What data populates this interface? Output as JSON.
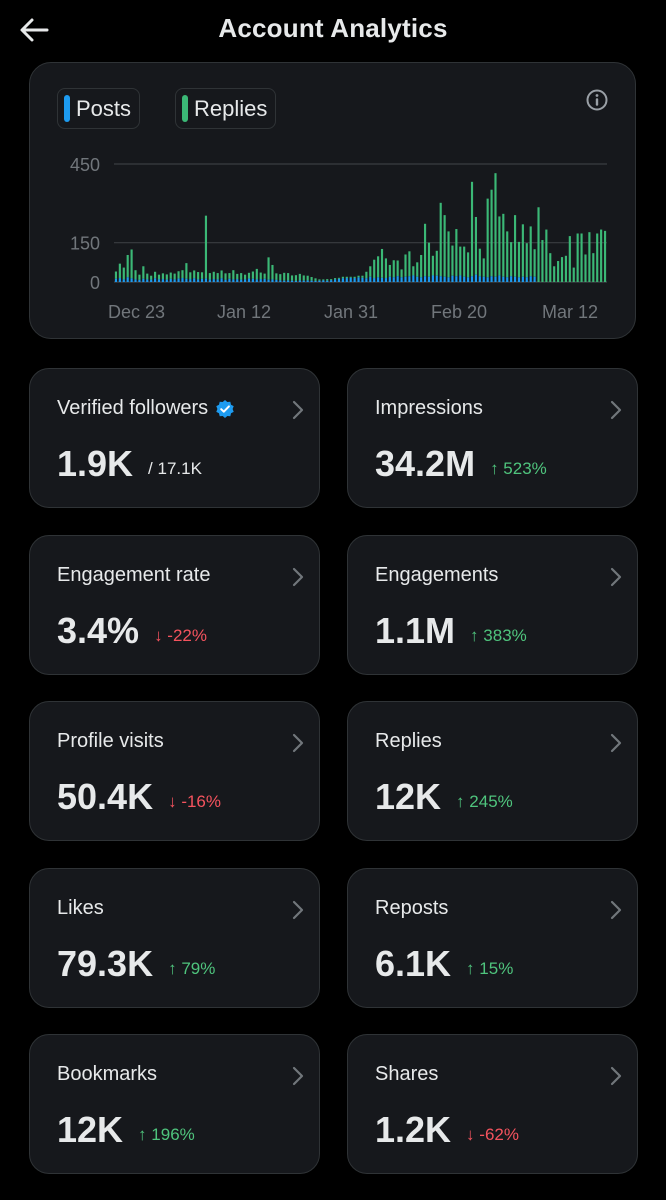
{
  "header": {
    "title": "Account Analytics"
  },
  "chart": {
    "legend": [
      {
        "label": "Posts",
        "color": "#1d9bf0"
      },
      {
        "label": "Replies",
        "color": "#3bb876"
      }
    ]
  },
  "chart_data": {
    "type": "bar",
    "title": "",
    "xlabel": "",
    "ylabel": "",
    "ylim": [
      0,
      450
    ],
    "yticks": [
      "450",
      "150",
      "0"
    ],
    "xtick_labels": [
      "Dec 23",
      "Jan 12",
      "Jan 31",
      "Feb 20",
      "Mar 12"
    ],
    "grid": true,
    "stacked": true,
    "series": [
      {
        "name": "Posts",
        "color": "#1d9bf0",
        "values": [
          12,
          15,
          10,
          18,
          14,
          10,
          8,
          12,
          10,
          9,
          14,
          10,
          11,
          9,
          12,
          10,
          13,
          15,
          12,
          11,
          14,
          10,
          12,
          13,
          9,
          11,
          10,
          14,
          8,
          12,
          10,
          11,
          9,
          10,
          13,
          12,
          10,
          11,
          12,
          9,
          10,
          8,
          6,
          5,
          6,
          5,
          4,
          6,
          5,
          6,
          5,
          4,
          5,
          6,
          5,
          7,
          10,
          12,
          14,
          15,
          16,
          15,
          18,
          16,
          14,
          20,
          15,
          18,
          16,
          15,
          20,
          18,
          22,
          18,
          20,
          22,
          25,
          20,
          18,
          22,
          20,
          25,
          24,
          22,
          20,
          18,
          24,
          22,
          25,
          20,
          18,
          22,
          28,
          22,
          20,
          18,
          22,
          20,
          25,
          20,
          18,
          22,
          20,
          18,
          20,
          18,
          22,
          20
        ]
      },
      {
        "name": "Replies",
        "color": "#3bb876",
        "values": [
          28,
          55,
          45,
          85,
          110,
          35,
          20,
          48,
          22,
          15,
          25,
          18,
          22,
          20,
          24,
          22,
          28,
          30,
          60,
          26,
          30,
          28,
          25,
          240,
          25,
          28,
          24,
          30,
          25,
          22,
          35,
          20,
          25,
          18,
          22,
          28,
          40,
          25,
          20,
          85,
          55,
          25,
          24,
          30,
          28,
          20,
          22,
          25,
          20,
          18,
          14,
          10,
          5,
          4,
          6,
          4,
          5,
          4,
          6,
          5,
          4,
          5,
          6,
          8,
          25,
          40,
          70,
          80,
          110,
          75,
          45,
          65,
          60,
          30,
          85,
          95,
          35,
          55,
          85,
          200,
          130,
          75,
          95,
          280,
          235,
          175,
          115,
          180,
          110,
          115,
          95,
          360,
          220,
          105,
          70,
          300,
          330,
          395,
          225,
          240,
          175,
          130,
          235,
          135,
          200,
          130,
          190,
          105,
          285,
          160,
          200,
          110,
          60,
          80,
          95,
          100,
          175,
          55,
          185,
          185,
          105,
          190,
          110,
          185,
          200,
          195
        ]
      }
    ]
  },
  "stats": [
    {
      "label": "Verified followers",
      "value": "1.9K",
      "sub": "/ 17.1K"
    },
    {
      "label": "Impressions",
      "value": "34.2M",
      "change": "523%",
      "direction": "up"
    },
    {
      "label": "Engagement rate",
      "value": "3.4%",
      "change": "-22%",
      "direction": "down"
    },
    {
      "label": "Engagements",
      "value": "1.1M",
      "change": "383%",
      "direction": "up"
    },
    {
      "label": "Profile visits",
      "value": "50.4K",
      "change": "-16%",
      "direction": "down"
    },
    {
      "label": "Replies",
      "value": "12K",
      "change": "245%",
      "direction": "up"
    },
    {
      "label": "Likes",
      "value": "79.3K",
      "change": "79%",
      "direction": "up"
    },
    {
      "label": "Reposts",
      "value": "6.1K",
      "change": "15%",
      "direction": "up"
    },
    {
      "label": "Bookmarks",
      "value": "12K",
      "change": "196%",
      "direction": "up"
    },
    {
      "label": "Shares",
      "value": "1.2K",
      "change": "-62%",
      "direction": "down"
    }
  ],
  "colors": {
    "up": "#4fc47d",
    "down": "#f4535e",
    "verified": "#1d9bf0",
    "card_bg": "#16181c"
  }
}
